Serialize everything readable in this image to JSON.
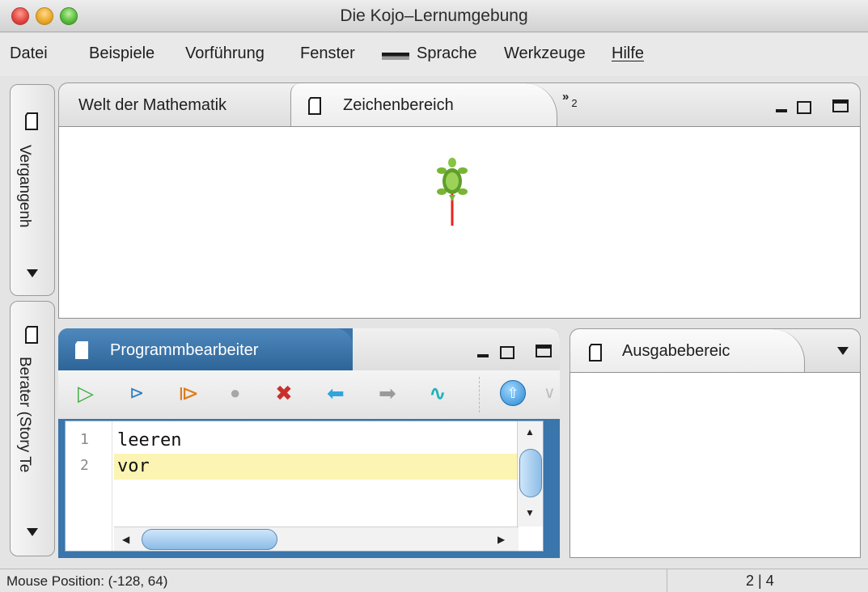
{
  "window": {
    "title": "Die Kojo–Lernumgebung"
  },
  "menu": {
    "datei": "Datei",
    "beispiele": "Beispiele",
    "vorfuehrung": "Vorführung",
    "fenster": "Fenster",
    "sprache": "Sprache",
    "werkzeuge": "Werkzeuge",
    "hilfe": "Hilfe"
  },
  "side_tabs": {
    "history": "Vergangenh",
    "storyteller": "Berater (Story Te"
  },
  "drawing_panel": {
    "tabs": [
      "Welt der Mathematik",
      "Zeichenbereich"
    ],
    "overflow_count": "2"
  },
  "editor": {
    "title": "Programmbearbeiter",
    "lines": [
      {
        "number": "1",
        "text": "leeren"
      },
      {
        "number": "2",
        "text": "vor"
      }
    ]
  },
  "output": {
    "title": "Ausgabebereic"
  },
  "status": {
    "mouse_position": "Mouse Position: (-128, 64)",
    "cursor_position": "2 | 4"
  },
  "colors": {
    "editor_tab": "#3a75ab",
    "current_line": "#fbf4b2",
    "turtle_line": "#e8231c"
  }
}
